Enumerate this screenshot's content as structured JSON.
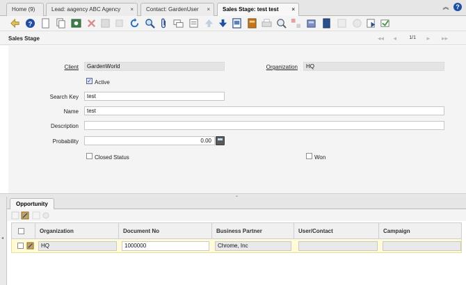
{
  "tabs": [
    {
      "label": "Home (9)",
      "closable": false,
      "active": false
    },
    {
      "label": "Lead: aagency ABC Agency",
      "closable": true,
      "active": false
    },
    {
      "label": "Contact: GardenUser",
      "closable": true,
      "active": false
    },
    {
      "label": "Sales Stage: test test",
      "closable": true,
      "active": true
    }
  ],
  "tab_close_glyph": "×",
  "help_glyph": "?",
  "collapse_glyph": "︽",
  "toolbar_icons": [
    "ignore-icon",
    "help-icon",
    "new-record-icon",
    "copy-record-icon",
    "save-create-icon",
    "delete-icon",
    "save-icon",
    "delete-selection-icon",
    "refresh-icon",
    "find-icon",
    "attachment-icon",
    "chat-icon",
    "history-icon",
    "previous-record-icon",
    "next-record-icon",
    "report-icon",
    "archive-icon",
    "print-icon",
    "zoom-across-icon",
    "active-workflows-icon",
    "requests-icon",
    "product-info-icon",
    "process-icon",
    "toggle-grid-icon",
    "export-icon",
    "customize-icon"
  ],
  "header": {
    "title": "Sales Stage",
    "record_counter": "1/1"
  },
  "form": {
    "client_label": "Client",
    "client_value": "GardenWorld",
    "organization_label": "Organization",
    "organization_value": "HQ",
    "active_label": "Active",
    "active_checked": true,
    "search_key_label": "Search Key",
    "search_key_value": "test",
    "name_label": "Name",
    "name_value": "test",
    "description_label": "Description",
    "description_value": "",
    "probability_label": "Probability",
    "probability_value": "0.00",
    "closed_status_label": "Closed Status",
    "closed_status_checked": false,
    "won_label": "Won",
    "won_checked": false
  },
  "detail": {
    "tab_label": "Opportunity",
    "columns": [
      "Organization",
      "Document No",
      "Business Partner",
      "User/Contact",
      "Campaign"
    ],
    "rows": [
      {
        "organization": "HQ",
        "document_no": "1000000",
        "business_partner": "Chrome, Inc",
        "user_contact": "",
        "campaign": ""
      }
    ]
  },
  "colors": {
    "accent": "#1e4fa5",
    "row_highlight": "#fffbd8"
  }
}
